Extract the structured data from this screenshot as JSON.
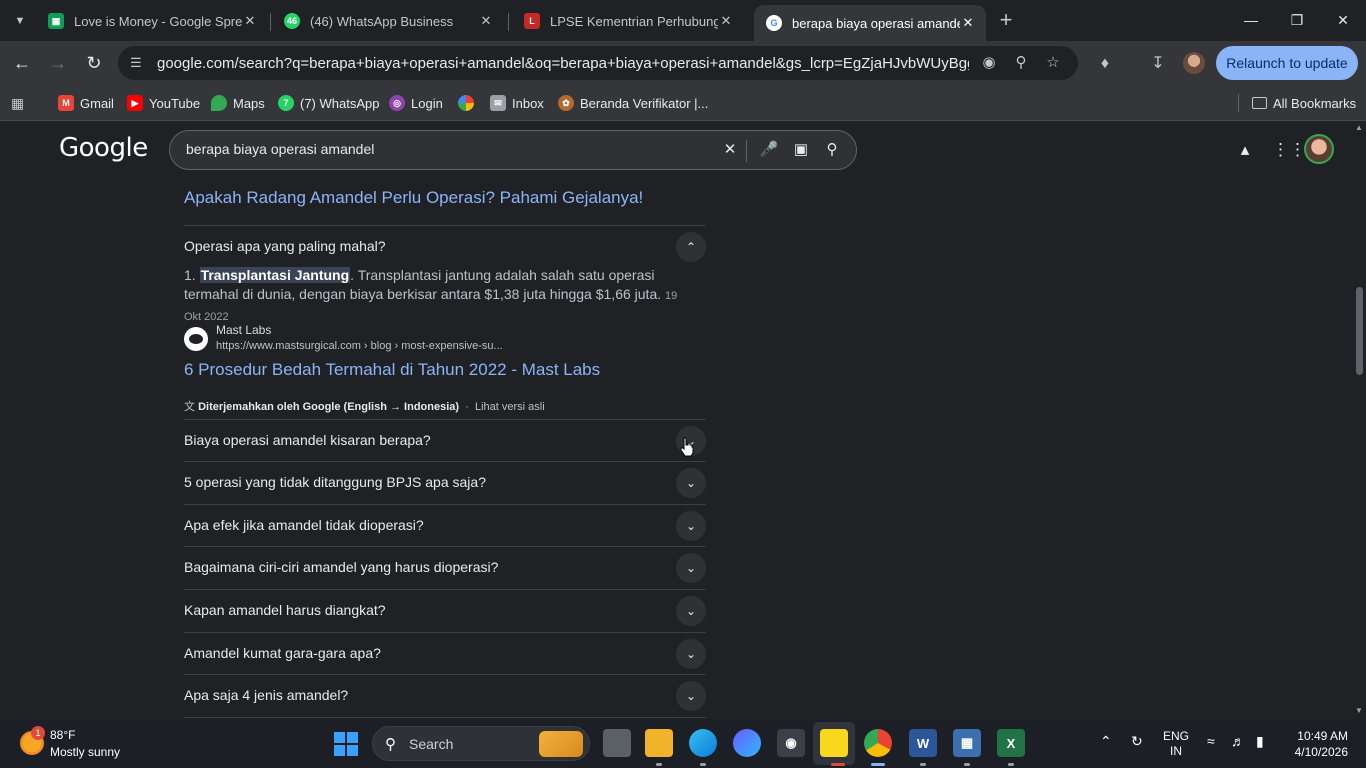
{
  "browser": {
    "tabs": [
      {
        "title": "Love is Money - Google Spread",
        "favicon": "sheets-icon",
        "color": "#0f9d58"
      },
      {
        "title": "(46) WhatsApp Business",
        "favicon": "whatsapp-icon",
        "color": "#25d366",
        "badge": "46"
      },
      {
        "title": "LPSE Kementrian Perhubungan",
        "favicon": "lpse-icon",
        "color": "#c62828"
      },
      {
        "title": "berapa biaya operasi amandel",
        "favicon": "google-icon",
        "color": "#4285f4"
      }
    ],
    "url": "google.com/search?q=berapa+biaya+operasi+amandel&oq=berapa+biaya+operasi+amandel&gs_lcrp=EgZjaHJvbWUyBggAEEU...",
    "relaunch_label": "Relaunch to update",
    "bookmarks": [
      {
        "label": "Gmail",
        "icon": "gmail-icon",
        "color": "#ea4335"
      },
      {
        "label": "YouTube",
        "icon": "youtube-icon",
        "color": "#ff0000"
      },
      {
        "label": "Maps",
        "icon": "maps-icon",
        "color": "#34a853"
      },
      {
        "label": "(7) WhatsApp",
        "icon": "whatsapp-icon",
        "color": "#25d366"
      },
      {
        "label": "Login",
        "icon": "login-icon",
        "color": "#8e44ad"
      },
      {
        "label": "",
        "icon": "photos-icon",
        "color": "#fbbc04"
      },
      {
        "label": "Inbox",
        "icon": "inbox-icon",
        "color": "#9aa0a6"
      },
      {
        "label": "Beranda Verifikator |...",
        "icon": "verifikator-icon",
        "color": "#b36b2c"
      }
    ],
    "all_bookmarks_label": "All Bookmarks"
  },
  "google": {
    "logo": "Google",
    "query": "berapa biaya operasi amandel",
    "prev_result_title": "Apakah Radang Amandel Perlu Operasi? Pahami Gejalanya!",
    "expanded_question": "Operasi apa yang paling mahal?",
    "snippet": {
      "prefix": "1. ",
      "highlight": "Transplantasi Jantung",
      "text": ". Transplantasi jantung adalah salah satu operasi termahal di dunia, dengan biaya berkisar antara $1,38 juta hingga $1,66 juta.",
      "date": "19 Okt 2022"
    },
    "source": {
      "name": "Mast Labs",
      "url": "https://www.mastsurgical.com › blog › most-expensive-su...",
      "title": "6 Prosedur Bedah Termahal di Tahun 2022 - Mast Labs"
    },
    "translated": {
      "label": "Diterjemahkan oleh Google (English → Indonesia)",
      "sep": "·",
      "original": "Lihat versi asli"
    },
    "questions": [
      "Biaya operasi amandel kisaran berapa?",
      "5 operasi yang tidak ditanggung BPJS apa saja?",
      "Apa efek jika amandel tidak dioperasi?",
      "Bagaimana ciri-ciri amandel yang harus dioperasi?",
      "Kapan amandel harus diangkat?",
      "Amandel kumat gara-gara apa?",
      "Apa saja 4 jenis amandel?"
    ]
  },
  "taskbar": {
    "weather_temp": "88°F",
    "weather_desc": "Mostly sunny",
    "weather_badge": "1",
    "search_placeholder": "Search",
    "lang_top": "ENG",
    "lang_bottom": "IN",
    "time": "10:49 AM",
    "date": "4/10/2026"
  }
}
